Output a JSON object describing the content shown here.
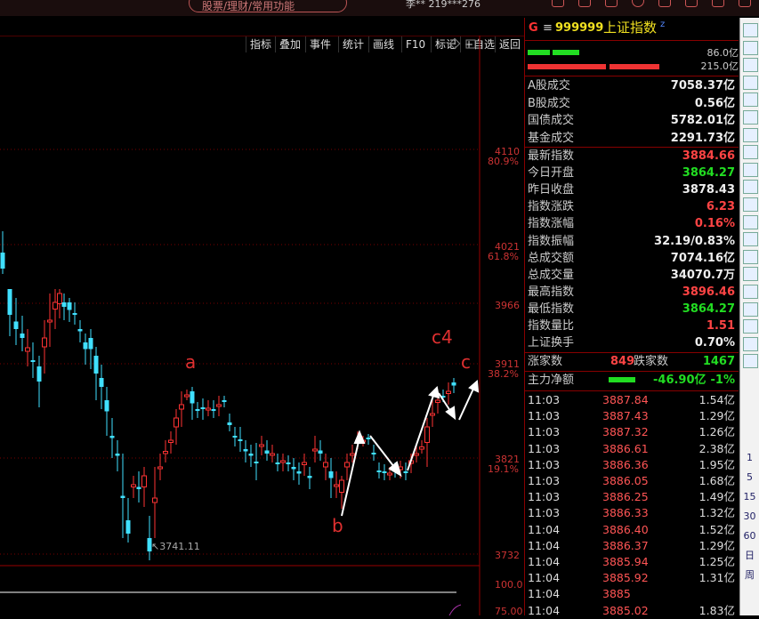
{
  "topbar": {
    "search_placeholder": "股票/理财/常用功能",
    "account": "李** 219***276"
  },
  "menu": [
    "指标",
    "叠加",
    "事件",
    "统计",
    "画线",
    "F10",
    "标记",
    "+自选",
    "返回"
  ],
  "chart": {
    "price_labels": [
      {
        "price": "4110",
        "pct": "80.9%"
      },
      {
        "price": "4021",
        "pct": "61.8%"
      },
      {
        "price": "3966",
        "pct": ""
      },
      {
        "price": "3911",
        "pct": "38.2%"
      },
      {
        "price": "3821",
        "pct": "19.1%"
      },
      {
        "price": "3732",
        "pct": ""
      }
    ],
    "low_marker": "3741.11",
    "annotations": [
      "a",
      "b",
      "c4",
      "c"
    ],
    "volume_labels": [
      "100.0",
      "75.00"
    ]
  },
  "panel": {
    "code": "999999",
    "name": "上证指数",
    "g_badge": "G",
    "bars": {
      "buy": "86.0亿",
      "sell": "215.0亿"
    },
    "turnover_rows": [
      {
        "label": "A股成交",
        "value": "7058.37亿",
        "color": "white"
      },
      {
        "label": "B股成交",
        "value": "0.56亿",
        "color": "white"
      },
      {
        "label": "国债成交",
        "value": "5782.01亿",
        "color": "white"
      },
      {
        "label": "基金成交",
        "value": "2291.73亿",
        "color": "white"
      }
    ],
    "index_rows": [
      {
        "label": "最新指数",
        "value": "3884.66",
        "color": "red"
      },
      {
        "label": "今日开盘",
        "value": "3864.27",
        "color": "green"
      },
      {
        "label": "昨日收盘",
        "value": "3878.43",
        "color": "white"
      },
      {
        "label": "指数涨跌",
        "value": "6.23",
        "color": "red"
      },
      {
        "label": "指数涨幅",
        "value": "0.16%",
        "color": "red"
      },
      {
        "label": "指数振幅",
        "value": "32.19/0.83%",
        "color": "white"
      },
      {
        "label": "总成交额",
        "value": "7074.16亿",
        "color": "white"
      },
      {
        "label": "总成交量",
        "value": "34070.7万",
        "color": "white"
      },
      {
        "label": "最高指数",
        "value": "3896.46",
        "color": "red"
      },
      {
        "label": "最低指数",
        "value": "3864.27",
        "color": "green"
      },
      {
        "label": "指数量比",
        "value": "1.51",
        "color": "red"
      },
      {
        "label": "上证换手",
        "value": "0.70%",
        "color": "white"
      }
    ],
    "breadth": {
      "up_label": "涨家数",
      "up": "849",
      "down_label": "跌家数",
      "down": "1467"
    },
    "main_flow": {
      "label": "主力净额",
      "value": "-46.90亿",
      "pct": "-1%"
    },
    "ticks": [
      {
        "t": "11:03",
        "p": "3887.84",
        "v": "1.54亿"
      },
      {
        "t": "11:03",
        "p": "3887.43",
        "v": "1.29亿"
      },
      {
        "t": "11:03",
        "p": "3887.32",
        "v": "1.26亿"
      },
      {
        "t": "11:03",
        "p": "3886.61",
        "v": "2.38亿"
      },
      {
        "t": "11:03",
        "p": "3886.36",
        "v": "1.95亿"
      },
      {
        "t": "11:03",
        "p": "3886.05",
        "v": "1.68亿"
      },
      {
        "t": "11:03",
        "p": "3886.25",
        "v": "1.49亿"
      },
      {
        "t": "11:03",
        "p": "3886.33",
        "v": "1.32亿"
      },
      {
        "t": "11:04",
        "p": "3886.40",
        "v": "1.52亿"
      },
      {
        "t": "11:04",
        "p": "3886.37",
        "v": "1.29亿"
      },
      {
        "t": "11:04",
        "p": "3885.94",
        "v": "1.25亿"
      },
      {
        "t": "11:04",
        "p": "3885.92",
        "v": "1.31亿"
      },
      {
        "t": "11:04",
        "p": "3885",
        "v": ""
      },
      {
        "t": "11:04",
        "p": "3885.02",
        "v": "1.83亿"
      }
    ]
  },
  "sidebar": [
    "1",
    "5",
    "15",
    "30",
    "60",
    "日",
    "周"
  ]
}
